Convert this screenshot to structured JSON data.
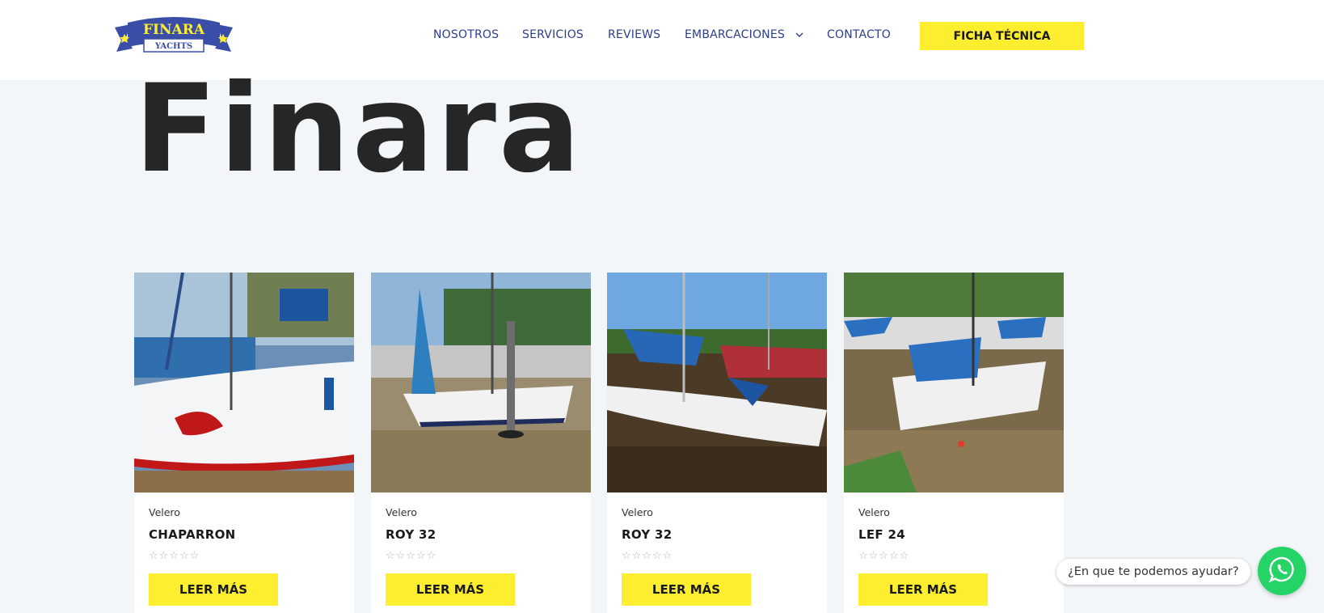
{
  "brand": {
    "logo_top": "FINARA",
    "logo_bottom": "YACHTS",
    "logo_color": "#3a4ea8",
    "accent": "#fdee2f"
  },
  "nav": {
    "items": [
      {
        "label": "NOSOTROS"
      },
      {
        "label": "SERVICIOS"
      },
      {
        "label": "REVIEWS"
      },
      {
        "label": "EMBARCACIONES"
      },
      {
        "label": "CONTACTO"
      }
    ],
    "cta_label": "FICHA TÉCNICA"
  },
  "hero": {
    "title": "Finara"
  },
  "products": [
    {
      "category": "Velero",
      "name": "CHAPARRON",
      "rating": 0,
      "button": "LEER MÁS"
    },
    {
      "category": "Velero",
      "name": "ROY 32",
      "rating": 0,
      "button": "LEER MÁS"
    },
    {
      "category": "Velero",
      "name": "ROY 32",
      "rating": 0,
      "button": "LEER MÁS"
    },
    {
      "category": "Velero",
      "name": "LEF 24",
      "rating": 0,
      "button": "LEER MÁS"
    }
  ],
  "chat": {
    "prompt": "¿En que te podemos ayudar?",
    "icon": "whatsapp-icon",
    "color": "#25d366"
  }
}
